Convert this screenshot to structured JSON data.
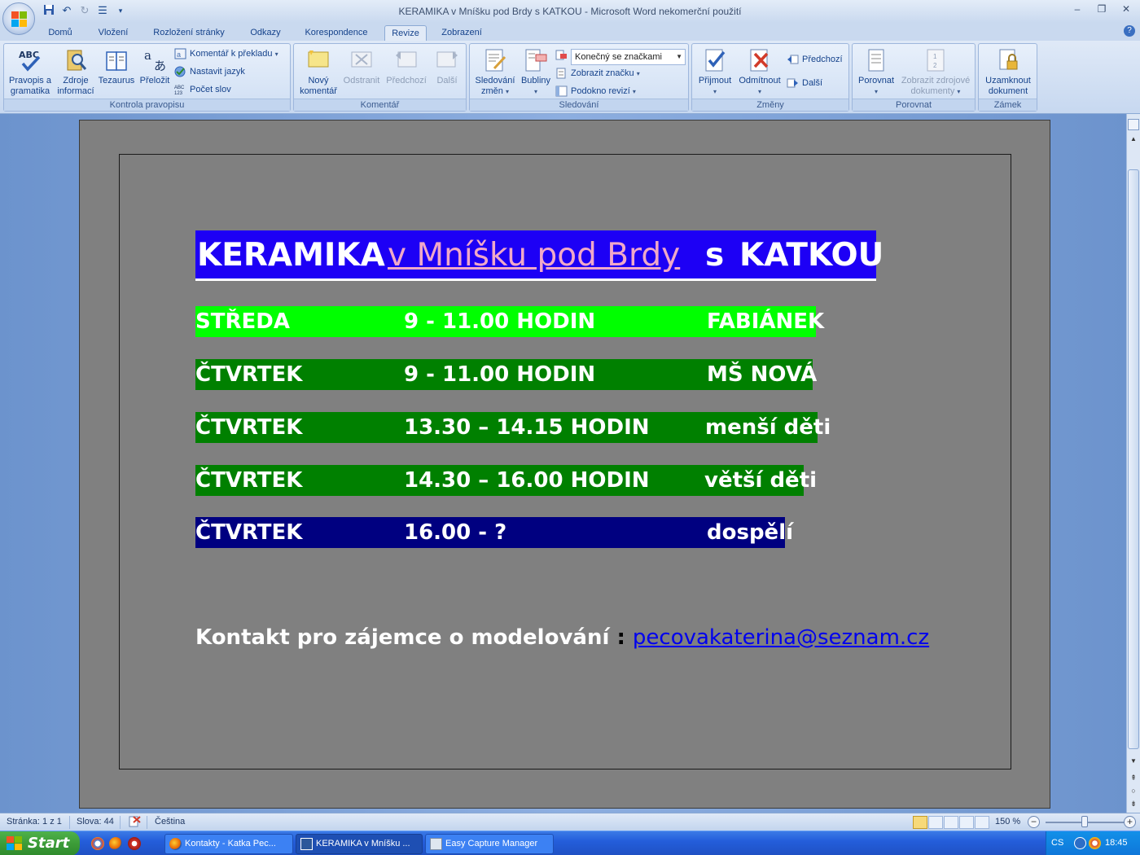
{
  "window": {
    "title": "KERAMIKA  v Mníšku pod Brdy  s  KATKOU - Microsoft Word nekomerční použití"
  },
  "tabs": [
    "Domů",
    "Vložení",
    "Rozložení stránky",
    "Odkazy",
    "Korespondence",
    "Revize",
    "Zobrazení"
  ],
  "active_tab": "Revize",
  "ribbon": {
    "proofing": {
      "label": "Kontrola pravopisu",
      "spelling": [
        "Pravopis a",
        "gramatika"
      ],
      "research": [
        "Zdroje",
        "informací"
      ],
      "thesaurus": "Tezaurus",
      "translate": "Přeložit",
      "translation_tip": "Komentář k překladu",
      "set_language": "Nastavit jazyk",
      "word_count": "Počet slov"
    },
    "comments": {
      "label": "Komentář",
      "new": [
        "Nový",
        "komentář"
      ],
      "delete": "Odstranit",
      "previous": "Předchozí",
      "next": "Další"
    },
    "tracking": {
      "label": "Sledování",
      "track_changes": [
        "Sledování",
        "změn"
      ],
      "balloons": "Bubliny",
      "display_for_review": "Konečný se značkami",
      "show_markup": "Zobrazit značku",
      "reviewing_pane": "Podokno revizí"
    },
    "changes": {
      "label": "Změny",
      "accept": "Přijmout",
      "reject": "Odmítnout",
      "previous": "Předchozí",
      "next": "Další"
    },
    "compare": {
      "label": "Porovnat",
      "compare": "Porovnat",
      "show_source": [
        "Zobrazit zdrojové",
        "dokumenty"
      ]
    },
    "protect": {
      "label": "Zámek",
      "protect_document": [
        "Uzamknout",
        "dokument"
      ]
    }
  },
  "document": {
    "heading": {
      "part1": "KERAMIKA",
      "part2": "v Mníšku pod Brdy",
      "part3": "s",
      "part4": "KATKOU"
    },
    "schedule": [
      {
        "day": "STŘEDA",
        "time": "9 - 11.00 HODIN",
        "place": "FABIÁNEK",
        "color": "#00ff00"
      },
      {
        "day": "ČTVRTEK",
        "time": "9 - 11.00 HODIN",
        "place": "MŠ NOVÁ",
        "color": "#008000"
      },
      {
        "day": "ČTVRTEK",
        "time": "13.30 – 14.15 HODIN",
        "place": "menší děti",
        "color": "#008000"
      },
      {
        "day": "ČTVRTEK",
        "time": "14.30 – 16.00 HODIN",
        "place": "větší děti",
        "color": "#008000"
      },
      {
        "day": "ČTVRTEK",
        "time": "16.00 - ?",
        "place": "dospělí",
        "color": "#000080"
      }
    ],
    "contact_label": "Kontakt pro zájemce o modelování",
    "contact_sep": ":",
    "contact_email": "pecovakaterina@seznam.cz"
  },
  "statusbar": {
    "page": "Stránka: 1 z 1",
    "words": "Slova: 44",
    "language": "Čeština",
    "zoom": "150 %"
  },
  "taskbar": {
    "start": "Start",
    "tasks": [
      "Kontakty - Katka Pec...",
      "KERAMIKA  v Mníšku ...",
      "Easy Capture Manager"
    ],
    "tray_lang": "CS",
    "clock": "18:45"
  }
}
